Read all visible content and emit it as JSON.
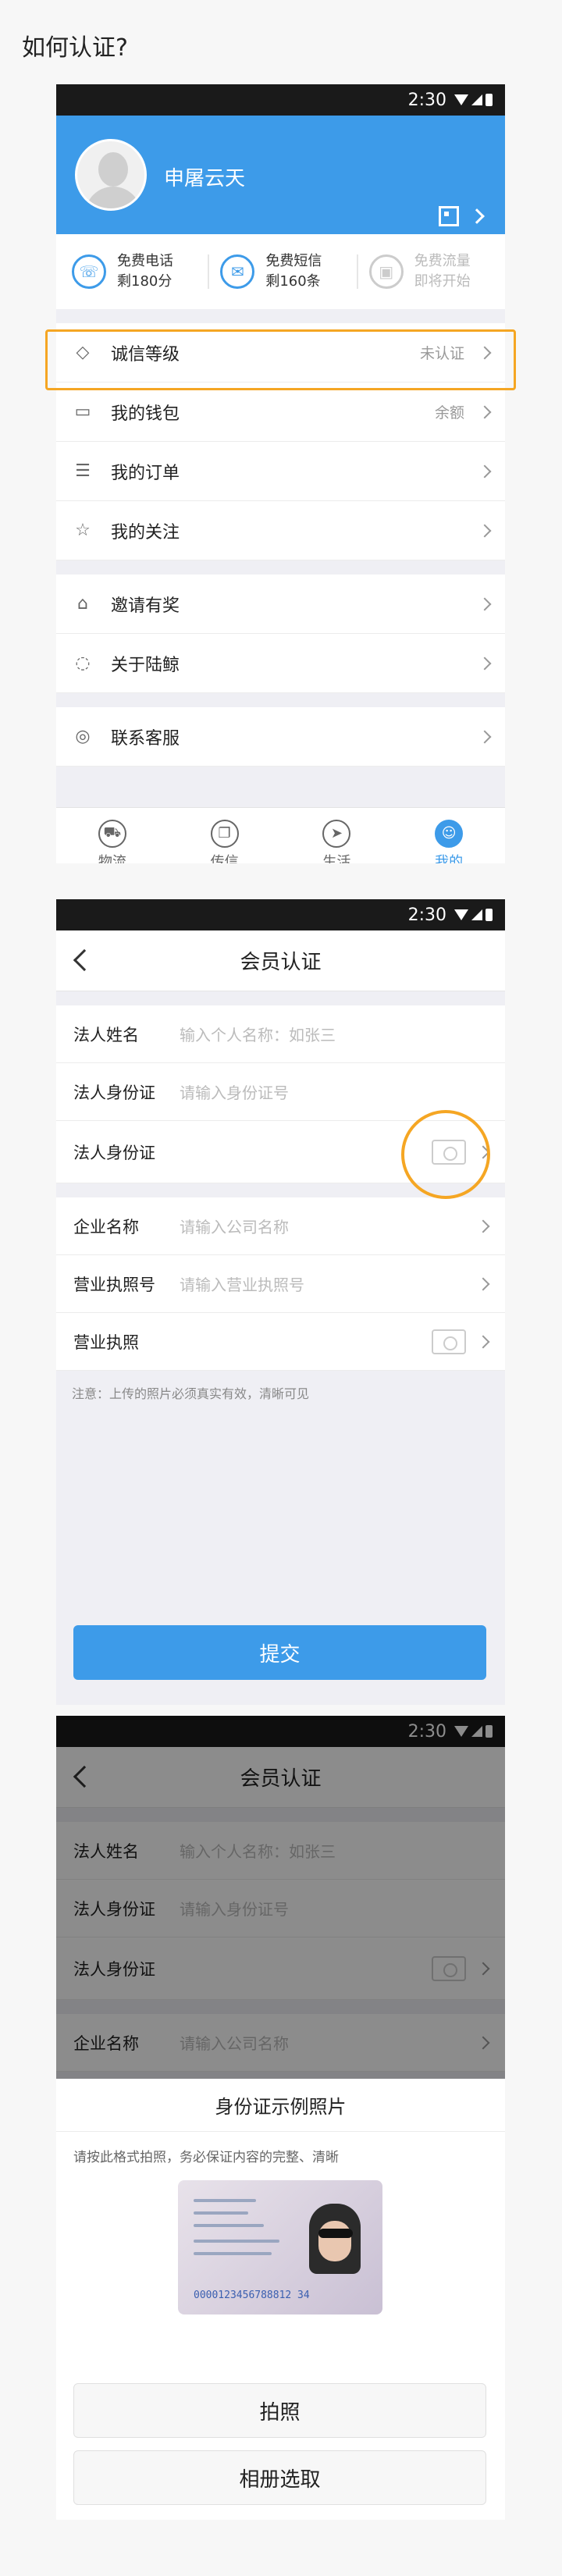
{
  "page_title": "如何认证?",
  "status_time": "2:30",
  "screen1": {
    "username": "申屠云天",
    "comm": [
      {
        "title": "免费电话",
        "sub": "剩180分"
      },
      {
        "title": "免费短信",
        "sub": "剩160条"
      },
      {
        "title": "免费流量",
        "sub": "即将开始"
      }
    ],
    "list_a": [
      {
        "label": "诚信等级",
        "value": "未认证",
        "icon": "diamond-icon"
      },
      {
        "label": "我的钱包",
        "value": "余额",
        "icon": "wallet-icon"
      },
      {
        "label": "我的订单",
        "value": "",
        "icon": "order-icon"
      },
      {
        "label": "我的关注",
        "value": "",
        "icon": "star-icon"
      }
    ],
    "list_b": [
      {
        "label": "邀请有奖",
        "icon": "gift-icon"
      },
      {
        "label": "关于陆鲸",
        "icon": "whale-icon"
      }
    ],
    "list_c": [
      {
        "label": "联系客服",
        "icon": "headset-icon"
      }
    ],
    "tabs": [
      {
        "label": "物流",
        "icon": "truck-icon"
      },
      {
        "label": "传信",
        "icon": "message-icon"
      },
      {
        "label": "生活",
        "icon": "compass-icon"
      },
      {
        "label": "我的",
        "icon": "user-icon",
        "active": true
      }
    ]
  },
  "screen2": {
    "title": "会员认证",
    "fields": [
      {
        "label": "法人姓名",
        "placeholder": "输入个人名称：如张三"
      },
      {
        "label": "法人身份证",
        "placeholder": "请输入身份证号"
      },
      {
        "label": "法人身份证",
        "placeholder": ""
      },
      {
        "label": "企业名称",
        "placeholder": "请输入公司名称"
      },
      {
        "label": "营业执照号",
        "placeholder": "请输入营业执照号"
      },
      {
        "label": "营业执照",
        "placeholder": ""
      }
    ],
    "note": "注意：上传的照片必须真实有效，清晰可见",
    "submit": "提交"
  },
  "screen3": {
    "title": "会员认证",
    "fields": [
      {
        "label": "法人姓名",
        "placeholder": "输入个人名称：如张三"
      },
      {
        "label": "法人身份证",
        "placeholder": "请输入身份证号"
      },
      {
        "label": "法人身份证",
        "placeholder": ""
      },
      {
        "label": "企业名称",
        "placeholder": "请输入公司名称"
      }
    ],
    "sheet_title": "身份证示例照片",
    "sheet_hint": "请按此格式拍照，务必保证内容的完整、清晰",
    "card_number": "0000123456788812 34",
    "btn_photo": "拍照",
    "btn_album": "相册选取"
  },
  "colors": {
    "accent": "#3d9be9",
    "highlight": "#f5a623"
  }
}
